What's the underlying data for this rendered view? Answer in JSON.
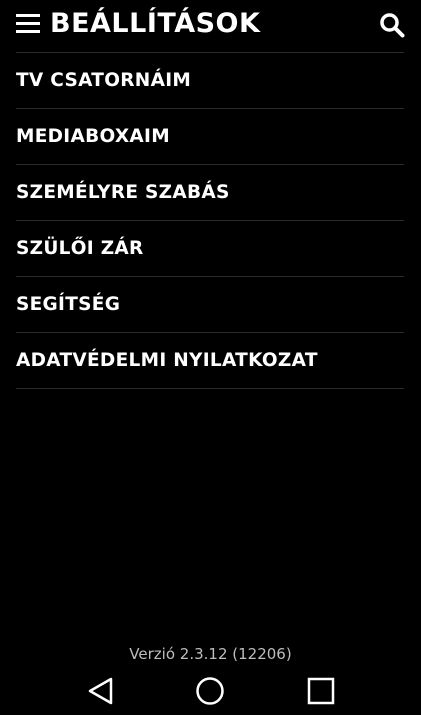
{
  "header": {
    "title": "BEÁLLÍTÁSOK",
    "menu_icon": "hamburger-menu-icon",
    "search_icon": "search-icon"
  },
  "menu": {
    "items": [
      {
        "label": "TV CSATORNÁIM"
      },
      {
        "label": "MEDIABOXAIM"
      },
      {
        "label": "SZEMÉLYRE SZABÁS"
      },
      {
        "label": "SZÜLŐI ZÁR"
      },
      {
        "label": "SEGÍTSÉG"
      },
      {
        "label": "ADATVÉDELMI NYILATKOZAT"
      }
    ]
  },
  "footer": {
    "version": "Verzió 2.3.12 (12206)"
  },
  "navbar": {
    "back_icon": "back-triangle-icon",
    "home_icon": "home-circle-icon",
    "recent_icon": "recent-apps-square-icon"
  },
  "colors": {
    "background": "#000000",
    "text": "#ffffff",
    "divider": "#2b2b2b",
    "version_text": "#bdbdbd"
  }
}
